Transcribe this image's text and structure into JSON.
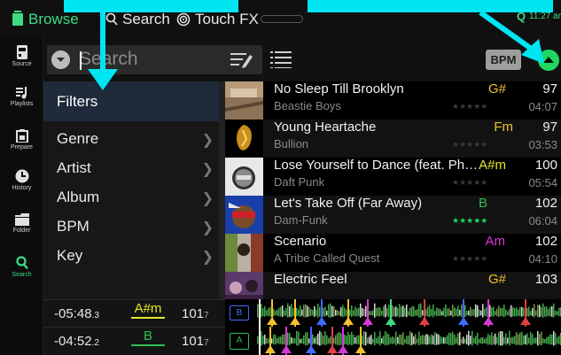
{
  "topbar": {
    "tabs": [
      {
        "label": "Browse",
        "icon": "browse-icon",
        "active": true
      },
      {
        "label": "Search",
        "icon": "search-icon",
        "active": false
      },
      {
        "label": "Touch FX",
        "icon": "touch-fx-icon",
        "active": false
      }
    ],
    "status_icon": "Q",
    "clock": "11:27 am"
  },
  "leftnav": {
    "items": [
      {
        "label": "Source",
        "icon": "source-icon",
        "active": false
      },
      {
        "label": "Playlists",
        "icon": "playlists-icon",
        "active": false
      },
      {
        "label": "Prepare",
        "icon": "prepare-icon",
        "active": false
      },
      {
        "label": "History",
        "icon": "history-icon",
        "active": false
      },
      {
        "label": "Folder",
        "icon": "folder-icon",
        "active": false
      },
      {
        "label": "Search",
        "icon": "search-icon",
        "active": true
      }
    ]
  },
  "search": {
    "placeholder": "Search",
    "bpm_button": "BPM"
  },
  "filters": {
    "header": "Filters",
    "items": [
      "Genre",
      "Artist",
      "Album",
      "BPM",
      "Key"
    ]
  },
  "tracks": [
    {
      "title": "No Sleep Till Brooklyn",
      "artist": "Beastie Boys",
      "key": "G#",
      "key_color": "#f2c12e",
      "stars": "★★★★★",
      "rated": false,
      "bpm": "97",
      "duration": "04:07"
    },
    {
      "title": "Young Heartache",
      "artist": "Bullion",
      "key": "Fm",
      "key_color": "#f2c12e",
      "stars": "★★★★★",
      "rated": false,
      "bpm": "97",
      "duration": "03:53"
    },
    {
      "title": "Lose Yourself to Dance (feat. Ph…",
      "artist": "Daft Punk",
      "key": "A#m",
      "key_color": "#e6e62a",
      "stars": "★★★★★",
      "rated": false,
      "bpm": "100",
      "duration": "05:54"
    },
    {
      "title": "Let's Take Off (Far Away)",
      "artist": "Dam-Funk",
      "key": "B",
      "key_color": "#2fbf4f",
      "stars": "★★★★★",
      "rated": true,
      "bpm": "102",
      "duration": "06:04"
    },
    {
      "title": "Scenario",
      "artist": "A Tribe Called Quest",
      "key": "Am",
      "key_color": "#d63ad6",
      "stars": "★★★★★",
      "rated": false,
      "bpm": "102",
      "duration": "04:10"
    },
    {
      "title": "Electric Feel",
      "artist": "",
      "key": "G#",
      "key_color": "#f2c12e",
      "stars": "",
      "rated": false,
      "bpm": "103",
      "duration": ""
    }
  ],
  "decks": [
    {
      "letter": "B",
      "time": "-05:48",
      "time_sub": ".3",
      "key": "A#m",
      "key_color": "#e6e62a",
      "bpm": "101",
      "bpm_sub": "7",
      "accent": "#3d6bff"
    },
    {
      "letter": "A",
      "time": "-04:52",
      "time_sub": ".2",
      "key": "B",
      "key_color": "#2fbf4f",
      "bpm": "101",
      "bpm_sub": "7",
      "accent": "#2fbf4f"
    }
  ],
  "colors": {
    "accent_green": "#3ddc84",
    "annotation_cyan": "#00e5f2"
  }
}
